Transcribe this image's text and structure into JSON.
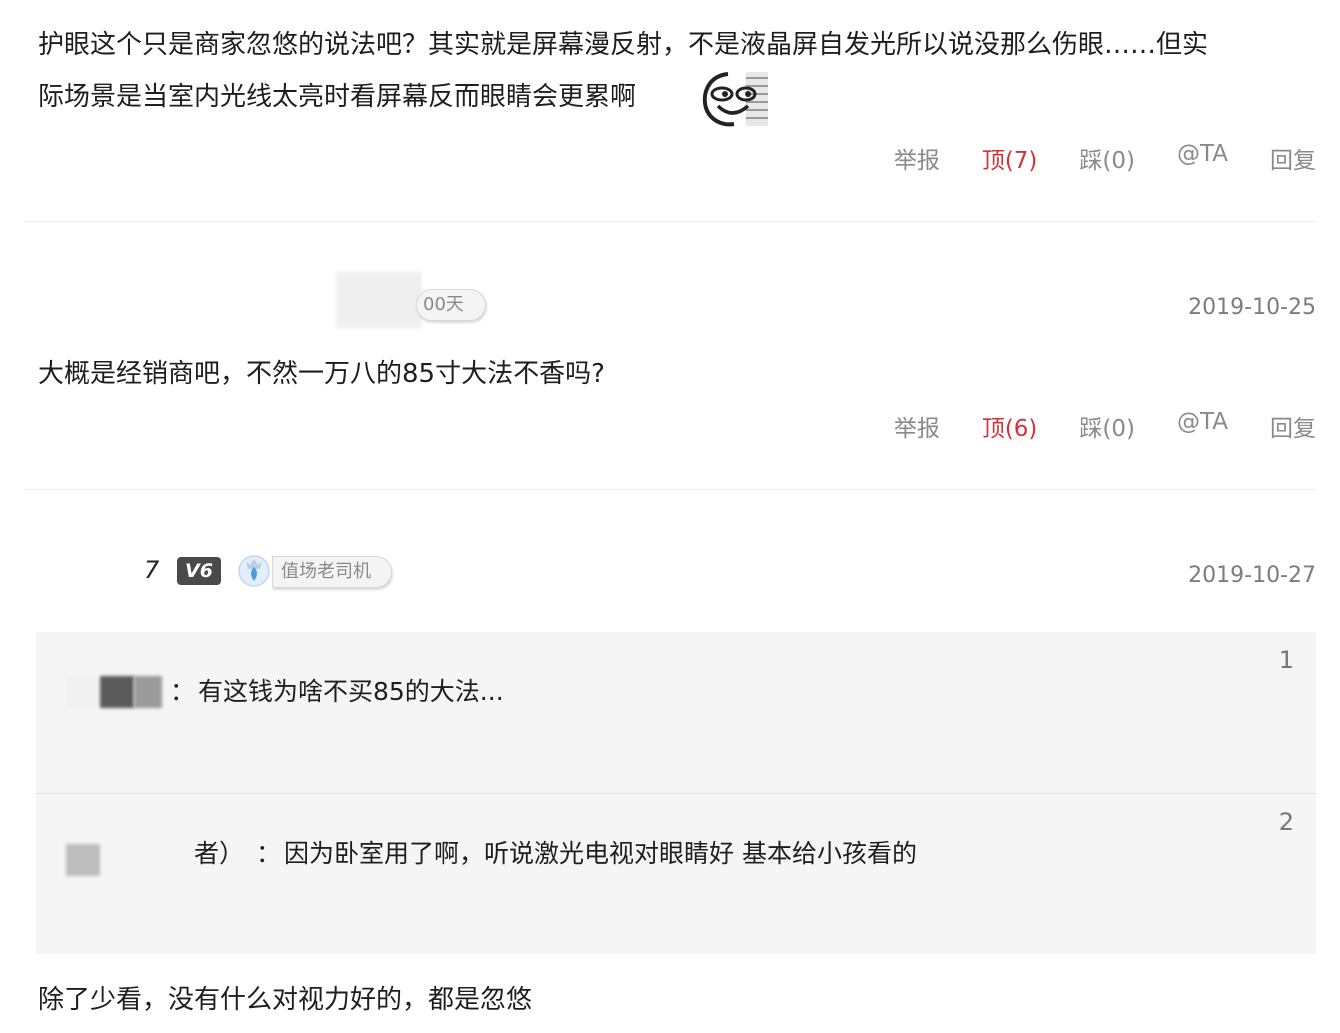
{
  "comment1": {
    "line1": "护眼这个只是商家忽悠的说法吧？其实就是屏幕漫反射，不是液晶屏自发光所以说没那么伤眼……但实",
    "line2": "际场景是当室内光线太亮时看屏幕反而眼睛会更累啊",
    "actions": {
      "report": "举报",
      "up": "顶(7)",
      "down": "踩(0)",
      "at": "@TA",
      "reply": "回复"
    }
  },
  "comment2": {
    "user_badge": "00天",
    "date": "2019-10-25",
    "text": "大概是经销商吧，不然一万八的85寸大法不香吗?",
    "actions": {
      "report": "举报",
      "up": "顶(6)",
      "down": "踩(0)",
      "at": "@TA",
      "reply": "回复"
    }
  },
  "comment3": {
    "user_fragment": "7",
    "level_badge": "V6",
    "title_badge": "值场老司机",
    "date": "2019-10-27",
    "quotes": [
      {
        "floor": "1",
        "separator": "：",
        "text": "有这钱为啥不买85的大法..."
      },
      {
        "floor": "2",
        "user_suffix": "者）",
        "separator": "：",
        "text": "因为卧室用了啊，听说激光电视对眼睛好 基本给小孩看的"
      }
    ],
    "text": "除了少看，没有什么对视力好的，都是忽悠"
  },
  "colors": {
    "up": "#d0343a",
    "muted": "#8a8a8a",
    "quote_bg": "#f5f5f5"
  }
}
